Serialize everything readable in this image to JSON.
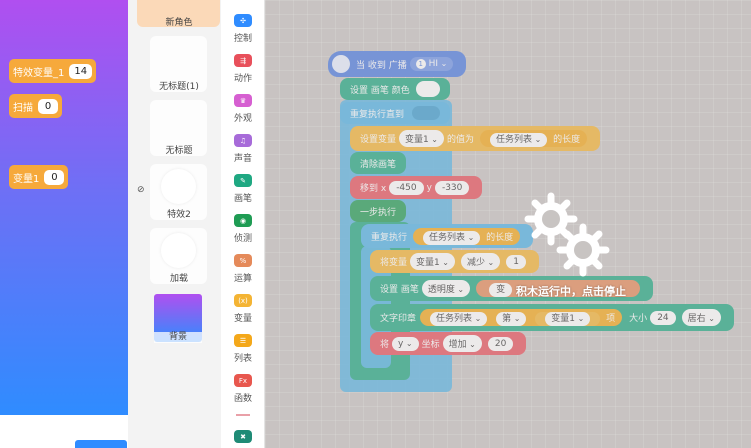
{
  "stage": {
    "monitors": [
      {
        "label": "特效变量_1",
        "value": "14"
      },
      {
        "label": "扫描",
        "value": "0"
      },
      {
        "label": "变量1",
        "value": "0"
      }
    ]
  },
  "sprites": {
    "items": [
      {
        "label": "新角色"
      },
      {
        "label": "无标题(1)"
      },
      {
        "label": "无标题"
      },
      {
        "label": "特效2"
      },
      {
        "label": "加载"
      },
      {
        "label": "背景"
      }
    ]
  },
  "categories": [
    {
      "label": "控制",
      "color": "#2f8cff",
      "icon": "control-icon"
    },
    {
      "label": "动作",
      "color": "#e8505b",
      "icon": "motion-icon"
    },
    {
      "label": "外观",
      "color": "#d65fd1",
      "icon": "looks-icon"
    },
    {
      "label": "声音",
      "color": "#a76bd9",
      "icon": "sound-icon"
    },
    {
      "label": "画笔",
      "color": "#1fa882",
      "icon": "pen-icon"
    },
    {
      "label": "侦测",
      "color": "#1f9c54",
      "icon": "sensing-icon"
    },
    {
      "label": "运算",
      "color": "#e58a5a",
      "icon": "operators-icon"
    },
    {
      "label": "变量",
      "color": "#f4b434",
      "icon": "variables-icon"
    },
    {
      "label": "列表",
      "color": "#f4a81a",
      "icon": "list-icon"
    },
    {
      "label": "函数",
      "color": "#e8574e",
      "icon": "functions-icon"
    }
  ],
  "blocks": {
    "hat": {
      "text": "当 收到 广播",
      "badge": "1",
      "message": "HI"
    },
    "set_pen_color": {
      "text": "设置 画笔 颜色"
    },
    "repeat_until": {
      "text": "重复执行直到"
    },
    "set_var": {
      "text": "设置变量",
      "var": "变量1",
      "mid": "的值为",
      "list": "任务列表",
      "suffix": "的长度"
    },
    "clear_pen": {
      "text": "清除画笔"
    },
    "move_to": {
      "text": "移到 x",
      "x": "-450",
      "ylabel": "y",
      "y": "-330"
    },
    "step": {
      "text": "一步执行"
    },
    "repeat": {
      "text": "重复执行",
      "list": "任务列表",
      "suffix": "的长度"
    },
    "change_var": {
      "text": "将变量",
      "var": "变量1",
      "op": "减少",
      "value": "1"
    },
    "set_pen_effect": {
      "text": "设置 画笔",
      "effect": "透明度",
      "op_text": "变"
    },
    "stamp_text": {
      "text": "文字印章",
      "list": "任务列表",
      "nth": "第",
      "var": "变量1",
      "item": "项",
      "size_label": "大小",
      "size": "24",
      "align": "居右"
    },
    "change_y": {
      "text": "将",
      "axis": "y",
      "coord": "坐标",
      "op": "增加",
      "value": "20"
    }
  },
  "running_overlay": {
    "text": "积木运行中，点击停止"
  }
}
